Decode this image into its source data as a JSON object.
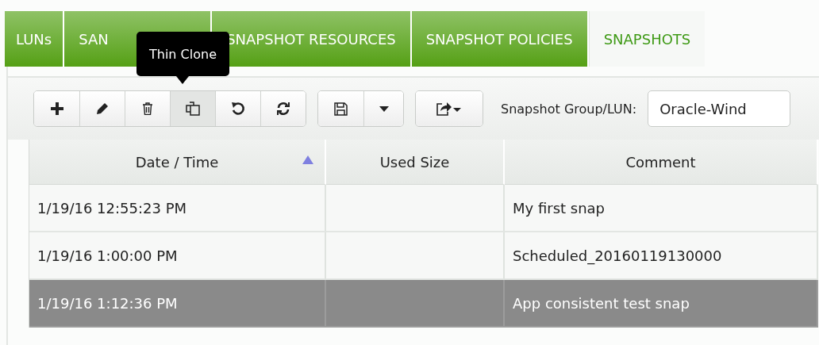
{
  "tabs": [
    {
      "label": "LUNs",
      "selected": false
    },
    {
      "label": "SAN",
      "selected": false
    },
    {
      "label": "SNAPSHOT RESOURCES",
      "selected": false
    },
    {
      "label": "SNAPSHOT POLICIES",
      "selected": false
    },
    {
      "label": "SNAPSHOTS",
      "selected": true
    }
  ],
  "toolbar": {
    "groups": [
      [
        {
          "kind": "add",
          "hovered": false
        },
        {
          "kind": "edit",
          "hovered": false
        },
        {
          "kind": "delete",
          "hovered": false
        },
        {
          "kind": "clone",
          "hovered": true
        },
        {
          "kind": "undo",
          "hovered": false
        },
        {
          "kind": "refresh",
          "hovered": false
        }
      ],
      [
        {
          "kind": "save",
          "hovered": false
        },
        {
          "kind": "dropdown",
          "hovered": false
        }
      ],
      [
        {
          "kind": "export",
          "hovered": false
        }
      ]
    ],
    "group_label": "Snapshot Group/LUN:",
    "group_value": "Oracle-Wind"
  },
  "tooltip": {
    "text": "Thin Clone"
  },
  "table": {
    "columns": [
      {
        "label": "Date / Time",
        "sort_ascending": true
      },
      {
        "label": "Used Size",
        "sort_ascending": false
      },
      {
        "label": "Comment",
        "sort_ascending": false
      }
    ],
    "rows": [
      {
        "cells": [
          "1/19/16 12:55:23 PM",
          "",
          "My first snap"
        ],
        "selected": false
      },
      {
        "cells": [
          "1/19/16 1:00:00 PM",
          "",
          "Scheduled_20160119130000"
        ],
        "selected": false
      },
      {
        "cells": [
          "1/19/16 1:12:36 PM",
          "",
          "App consistent test snap"
        ],
        "selected": true
      }
    ]
  }
}
